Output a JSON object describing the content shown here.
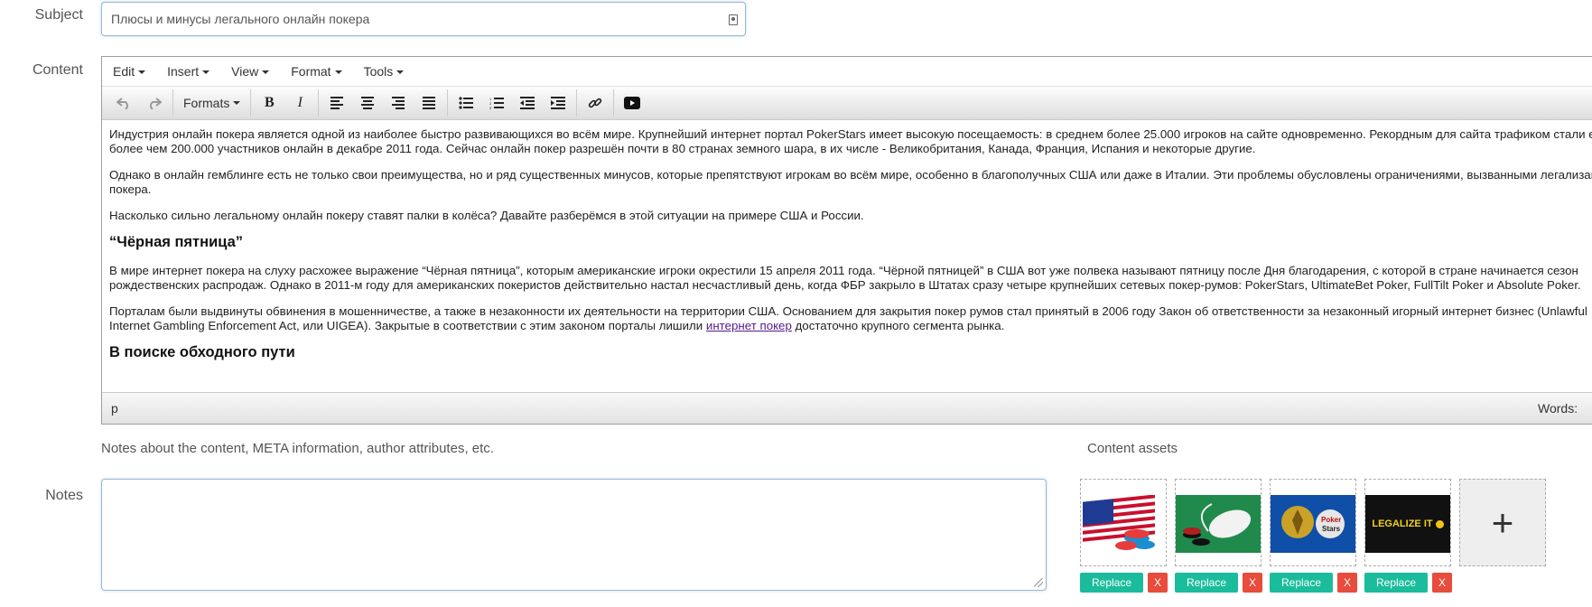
{
  "labels": {
    "subject": "Subject",
    "content": "Content",
    "notes": "Notes"
  },
  "subject": {
    "value": "Плюсы и минусы легального онлайн покера"
  },
  "editor": {
    "menu": [
      "Edit",
      "Insert",
      "View",
      "Format",
      "Tools"
    ],
    "formats_label": "Formats",
    "status_path": "p",
    "words_label": "Words:",
    "paragraphs": [
      "Индустрия онлайн покера является одной из наиболее быстро развивающихся во всём мире. Крупнейший интернет портал PokerStars имеет высокую посещаемость: в среднем более 25.000 игроков на сайте одновременно. Рекордным для сайта трафиком стали его более чем 200.000 участников онлайн в декабре 2011 года. Сейчас онлайн покер разрешён почти в 80 странах земного шара, в их числе - Великобритания, Канада, Франция, Испания и некоторые другие.",
      "Однако в онлайн гемблинге есть не только свои преимущества, но и ряд существенных минусов, которые препятствуют игрокам во всём мире, особенно в благополучных США или даже в Италии. Эти проблемы обусловлены ограничениями, вызванными легализацией покера.",
      "Насколько сильно легальному онлайн покеру ставят палки в колёса? Давайте разберёмся в этой ситуации на примере США и России."
    ],
    "heading1": "“Чёрная пятница”",
    "paragraph4": "В мире интернет покера на слуху расхожее выражение “Чёрная пятница”, которым американские игроки окрестили 15 апреля 2011 года. “Чёрной пятницей” в США вот уже полвека называют пятницу после Дня благодарения, с которой в стране начинается сезон рождественских распродаж. Однако в 2011-м году для американских покеристов действительно настал несчастливый день, когда ФБР закрыло в Штатах сразу четыре крупнейших сетевых покер-румов: PokerStars, UltimateBet Poker, FullTilt Poker и Absolute Poker.",
    "paragraph5_before": "Порталам были выдвинуты обвинения в мошенничестве, а также в незаконности их деятельности на территории США. Основанием для закрытия покер румов стал принятый в 2006 году Закон об ответственности за незаконный игорный интернет бизнес (Unlawful Internet Gambling Enforcement Act, или UIGEA). Закрытые в соответствии с этим законом порталы лишили ",
    "paragraph5_link": "интернет покер",
    "paragraph5_after": " достаточно крупного сегмента рынка.",
    "heading2": "В поиске обходного пути"
  },
  "notes": {
    "help": "Notes about the content, META information, author attributes, etc.",
    "value": ""
  },
  "assets": {
    "title": "Content assets",
    "replace_label": "Replace",
    "remove_label": "X",
    "add_label": "+",
    "items": [
      {
        "name": "usa-flag-chips"
      },
      {
        "name": "mouse-chips-green"
      },
      {
        "name": "pokerstars-emblem"
      },
      {
        "name": "legalize-it",
        "text": "LEGALIZE IT"
      }
    ]
  },
  "colors": {
    "replace": "#1abc9c",
    "remove": "#e74c3c",
    "link": "#551a8b"
  }
}
